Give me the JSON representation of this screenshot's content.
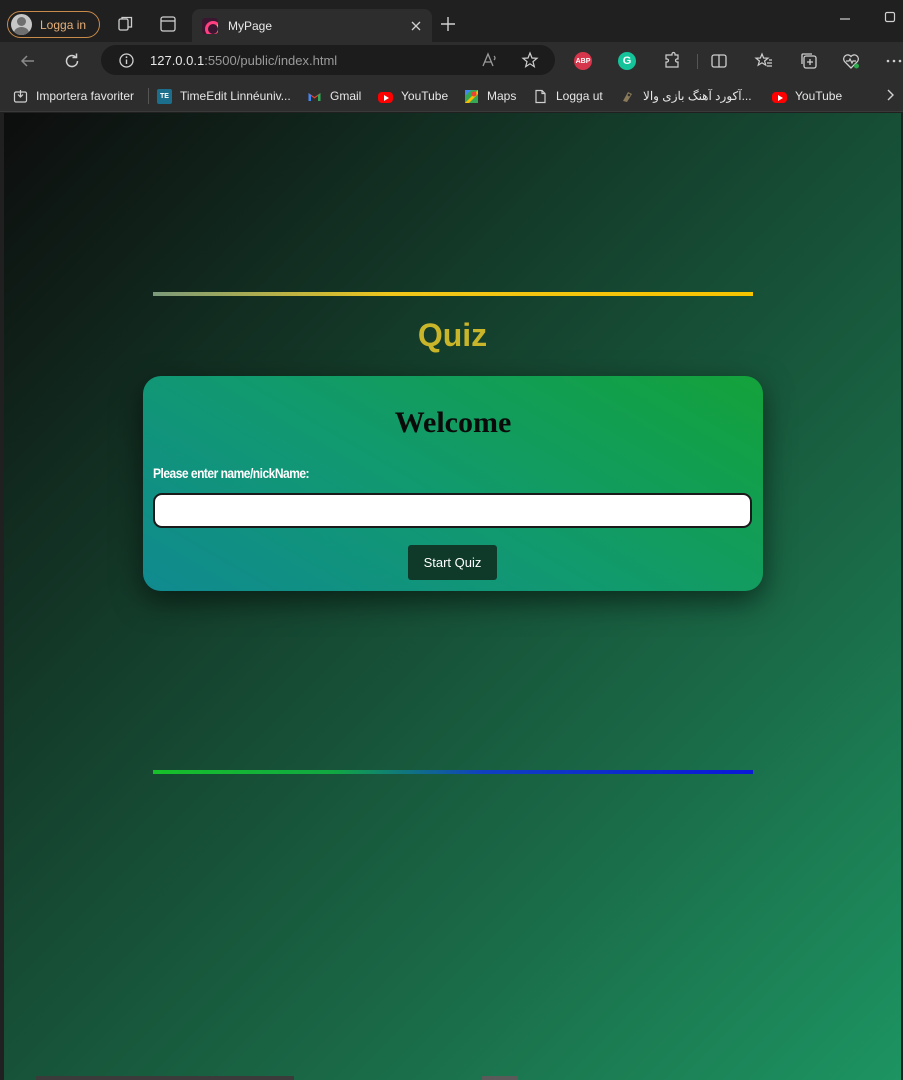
{
  "tabstrip": {
    "profile_label": "Logga in",
    "tab_title": "MyPage"
  },
  "toolbar": {
    "address_host": "127.0.0.1",
    "address_path": ":5500/public/index.html",
    "abp_label": "ABP",
    "grammarly_label": "G"
  },
  "bookmarks": {
    "items": [
      {
        "label": "Importera favoriter"
      },
      {
        "label": "TimeEdit Linnéuniv...",
        "icon_text": "TE"
      },
      {
        "label": "Gmail"
      },
      {
        "label": "YouTube"
      },
      {
        "label": "Maps"
      },
      {
        "label": "Logga ut"
      },
      {
        "label": "آکورد آهنگ بازی والا..."
      },
      {
        "label": "YouTube"
      }
    ]
  },
  "page": {
    "title": "Quiz",
    "card": {
      "heading": "Welcome",
      "name_label": "Please enter name/nickName:",
      "name_value": "",
      "start_button": "Start Quiz"
    }
  },
  "colors": {
    "accent_title": "#c9b52a",
    "button_bg": "#0f3a2a",
    "rule_top": "#f7c400",
    "rule_bottom": "#0a18d8"
  }
}
